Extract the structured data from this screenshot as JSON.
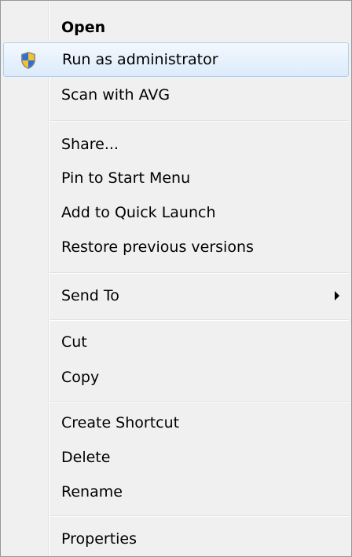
{
  "menu": {
    "items": [
      {
        "label": "Open"
      },
      {
        "label": "Run as administrator",
        "icon": "uac-shield-icon"
      },
      {
        "label": "Scan with AVG"
      },
      {
        "label": "Share..."
      },
      {
        "label": "Pin to Start Menu"
      },
      {
        "label": "Add to Quick Launch"
      },
      {
        "label": "Restore previous versions"
      },
      {
        "label": "Send To",
        "submenu_icon": "submenu-arrow-icon"
      },
      {
        "label": "Cut"
      },
      {
        "label": "Copy"
      },
      {
        "label": "Create Shortcut"
      },
      {
        "label": "Delete"
      },
      {
        "label": "Rename"
      },
      {
        "label": "Properties"
      }
    ],
    "highlighted_item": "Run as administrator",
    "colors": {
      "background": "#f0f0f0",
      "border": "#979797",
      "highlight_top": "#f3f8fd",
      "highlight_bottom": "#dcebfc",
      "highlight_border": "#b2d0eb"
    }
  }
}
